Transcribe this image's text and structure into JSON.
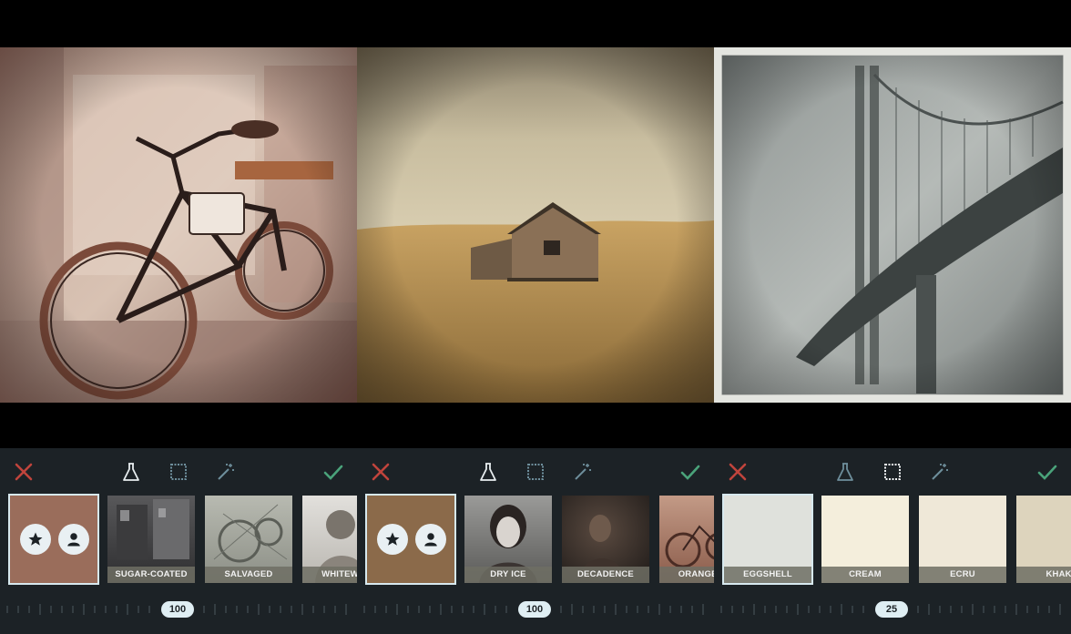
{
  "panels": [
    {
      "id": "bicycle",
      "cancel_icon": "close-icon",
      "confirm_icon": "check-icon",
      "tools": [
        "flask-icon",
        "border-icon",
        "magic-wand-icon"
      ],
      "active_tool": "flask-icon",
      "thumbnails": [
        {
          "label": ""
        },
        {
          "label": "SUGAR-COATED"
        },
        {
          "label": "SALVAGED"
        },
        {
          "label": "WHITEWAS"
        }
      ],
      "slider_value": "100",
      "accent_colors": {
        "cancel": "#c0443c",
        "confirm": "#4aa37a"
      }
    },
    {
      "id": "barn",
      "cancel_icon": "close-icon",
      "confirm_icon": "check-icon",
      "tools": [
        "flask-icon",
        "border-icon",
        "magic-wand-icon"
      ],
      "active_tool": "flask-icon",
      "thumbnails": [
        {
          "label": ""
        },
        {
          "label": "DRY ICE"
        },
        {
          "label": "DECADENCE"
        },
        {
          "label": "ORANGE ZI"
        }
      ],
      "slider_value": "100"
    },
    {
      "id": "bridge",
      "cancel_icon": "close-icon",
      "confirm_icon": "check-icon",
      "tools": [
        "flask-icon",
        "border-icon",
        "magic-wand-icon"
      ],
      "active_tool": "border-icon",
      "thumbnails": [
        {
          "label": "EGGSHELL"
        },
        {
          "label": "CREAM"
        },
        {
          "label": "ECRU"
        },
        {
          "label": "KHAKI"
        }
      ],
      "slider_value": "25",
      "swatch_colors": [
        "#dfe1dc",
        "#f4eedc",
        "#efe8d8",
        "#ddd4bd"
      ]
    }
  ]
}
